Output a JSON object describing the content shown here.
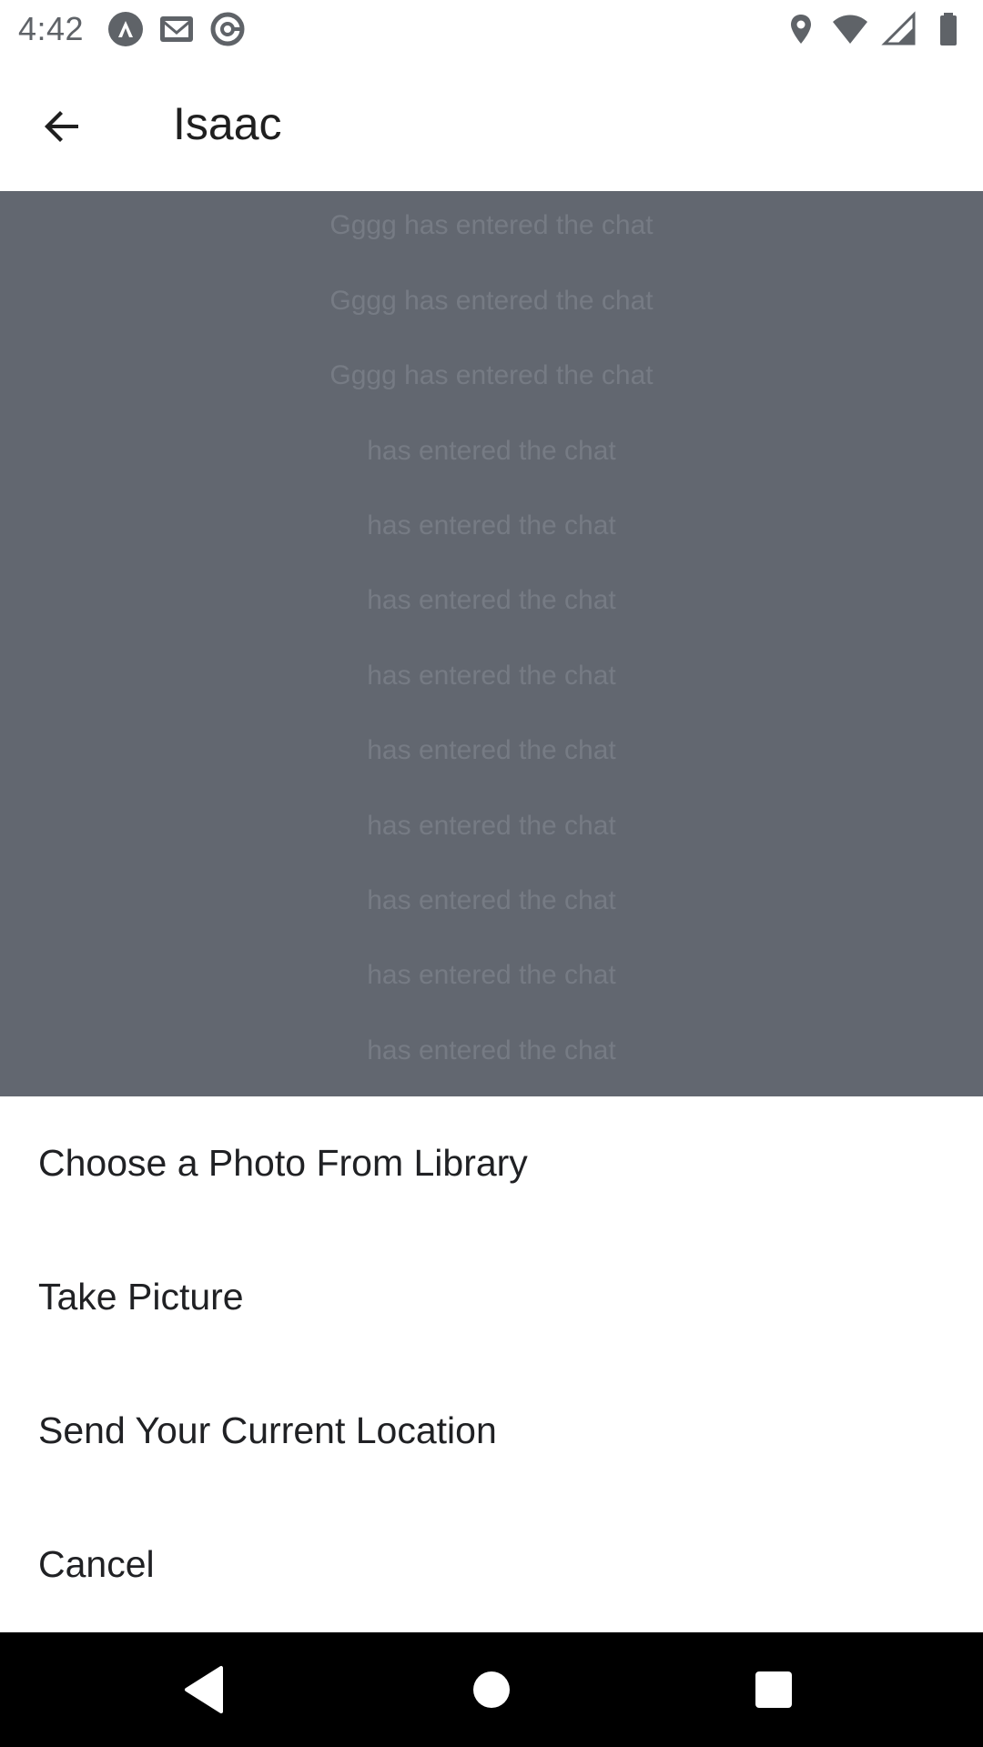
{
  "status_bar": {
    "time": "4:42",
    "left_icons": [
      "app-a-icon",
      "gmail-icon",
      "at-sign-icon"
    ],
    "right_icons": [
      "location-pin-icon",
      "wifi-icon",
      "cellular-signal-icon",
      "battery-icon"
    ]
  },
  "app_bar": {
    "title": "Isaac",
    "back_icon": "arrow-left-icon"
  },
  "chat": {
    "messages": [
      "Gggg has entered the chat",
      "Gggg has entered the chat",
      "Gggg has entered the chat",
      "has entered the chat",
      "has entered the chat",
      "has entered the chat",
      "has entered the chat",
      "has entered the chat",
      "has entered the chat",
      "has entered the chat",
      "has entered the chat",
      "has entered the chat"
    ]
  },
  "action_sheet": {
    "options": [
      "Choose a Photo From Library",
      "Take Picture",
      "Send Your Current Location",
      "Cancel"
    ]
  },
  "nav_bar": {
    "buttons": [
      "back-triangle-icon",
      "home-circle-icon",
      "recents-square-icon"
    ]
  },
  "colors": {
    "overlay": "#626770",
    "overlay_text": "#767b84",
    "sheet_background": "#ffffff",
    "nav_background": "#000000"
  }
}
